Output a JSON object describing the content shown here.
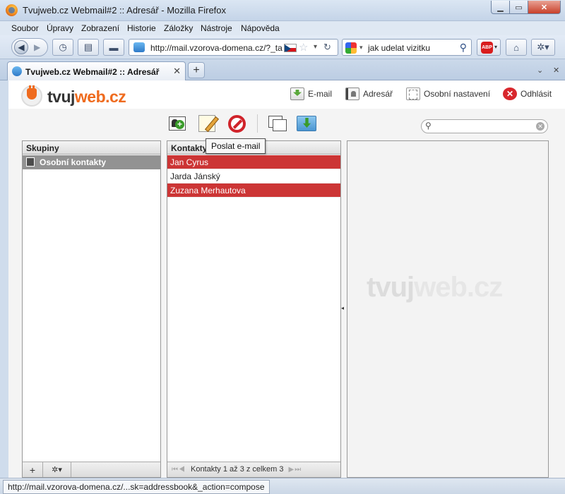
{
  "window": {
    "title": "Tvujweb.cz Webmail#2 :: Adresář - Mozilla Firefox"
  },
  "menu": [
    "Soubor",
    "Úpravy",
    "Zobrazení",
    "Historie",
    "Záložky",
    "Nástroje",
    "Nápověda"
  ],
  "navbar": {
    "url": "http://mail.vzorova-domena.cz/?_task=addressbook",
    "search_query": "jak udelat vizitku",
    "adblock_label": "ABP"
  },
  "tabs": [
    {
      "label": "Tvujweb.cz Webmail#2 :: Adresář"
    }
  ],
  "brand": {
    "part1": "tvuj",
    "part2": "web.cz",
    "color": "#ef6b1e"
  },
  "topnav": {
    "email": "E-mail",
    "addressbook": "Adresář",
    "settings": "Osobní nastavení",
    "logout": "Odhlásit"
  },
  "toolbar": {
    "tooltip": "Poslat e-mail"
  },
  "search": {
    "placeholder": "",
    "value": ""
  },
  "groups": {
    "header": "Skupiny",
    "items": [
      {
        "label": "Osobní kontakty",
        "selected": true
      }
    ]
  },
  "contacts": {
    "header": "Kontakty",
    "items": [
      {
        "name": "Jan Cyrus",
        "selected": true
      },
      {
        "name": "Jarda Jánský",
        "selected": false
      },
      {
        "name": "Zuzana Merhautova",
        "selected": true
      }
    ],
    "pager": "Kontakty 1 až 3 z celkem 3"
  },
  "groups_footer": {
    "add": "+",
    "settings": "✲▾"
  },
  "preview": {
    "watermark1": "tvuj",
    "watermark2": "web.cz"
  },
  "status": {
    "url": "http://mail.vzorova-domena.cz/...sk=addressbook&_action=compose"
  },
  "colors": {
    "selected_row": "#cc3535",
    "selected_group": "#929292"
  }
}
